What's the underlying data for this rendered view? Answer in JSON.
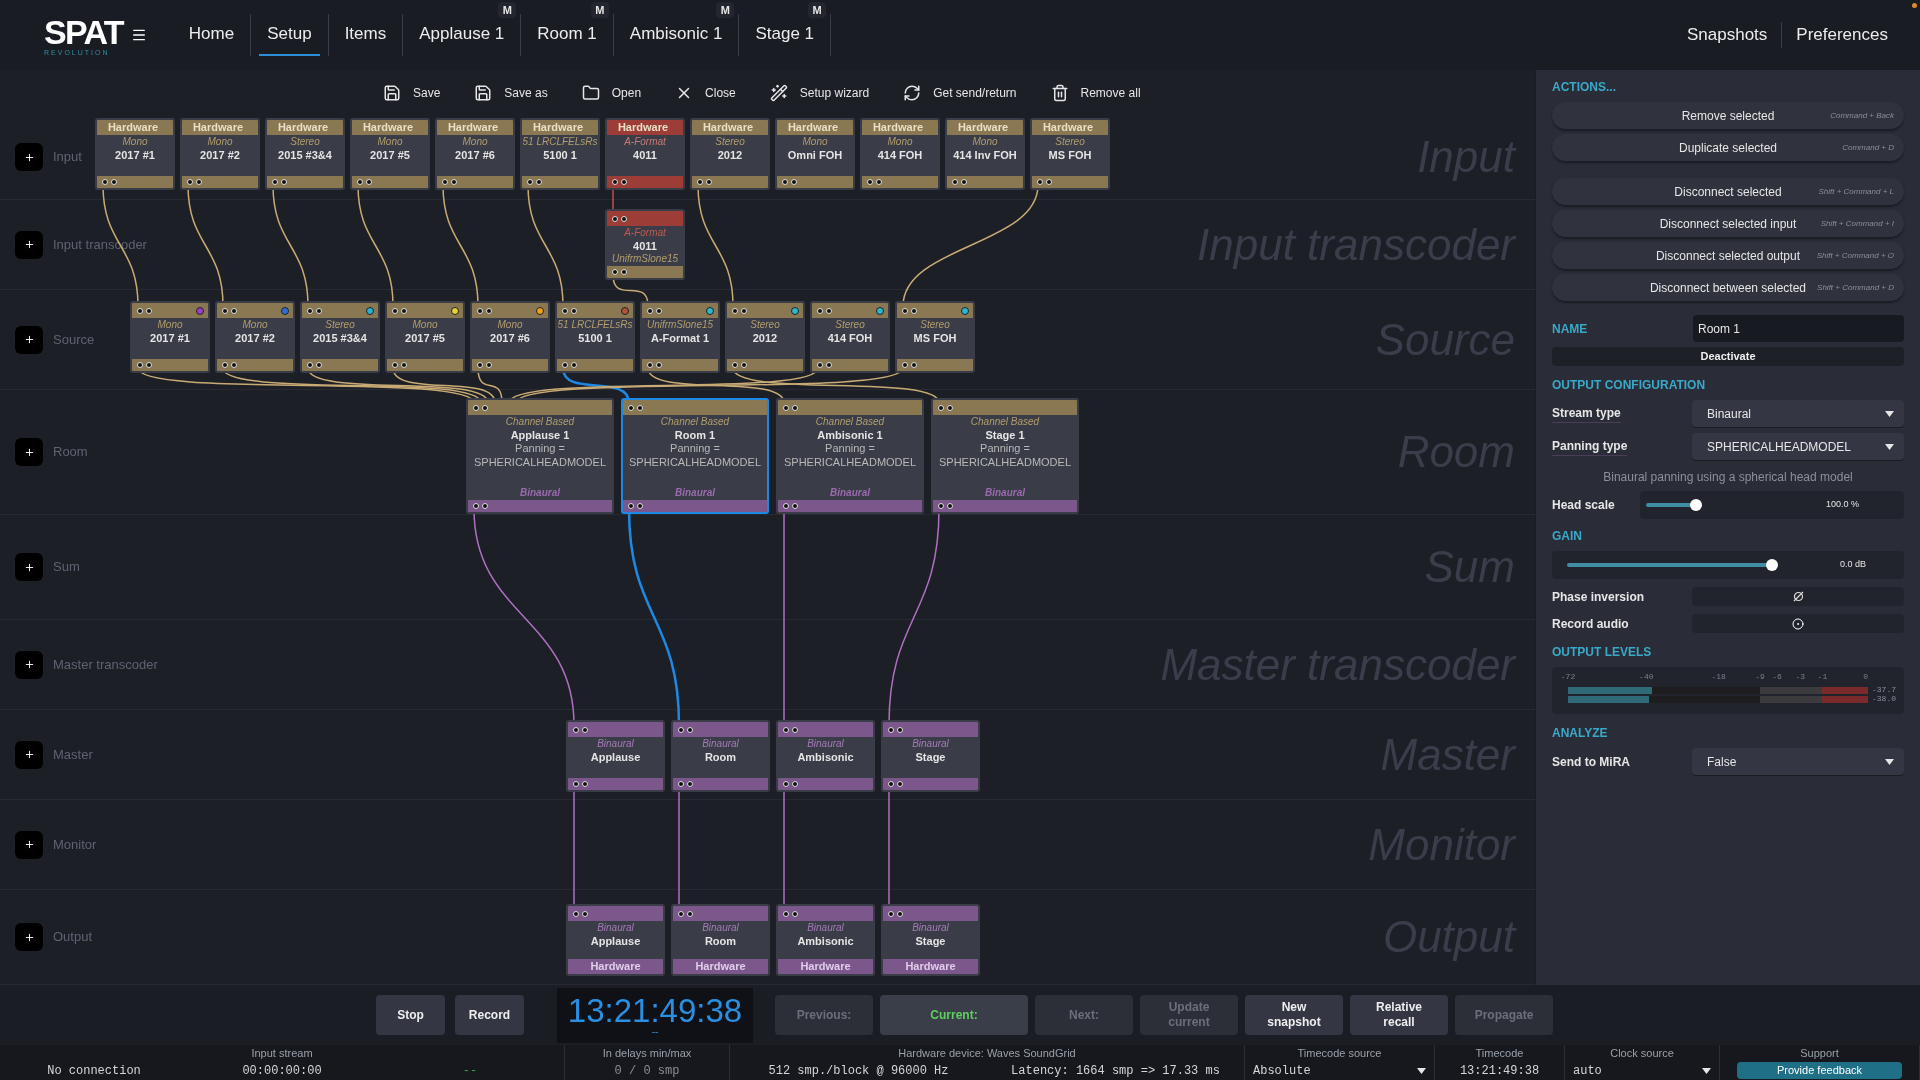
{
  "app": {
    "logo": "SPAT",
    "logo_sub": "REVOLUTION"
  },
  "nav": {
    "tabs": [
      {
        "label": "Home",
        "selected": false
      },
      {
        "label": "Setup",
        "selected": true
      },
      {
        "label": "Items",
        "selected": false
      },
      {
        "label": "Applause 1",
        "selected": false,
        "badge": "M"
      },
      {
        "label": "Room 1",
        "selected": false,
        "badge": "M"
      },
      {
        "label": "Ambisonic 1",
        "selected": false,
        "badge": "M"
      },
      {
        "label": "Stage 1",
        "selected": false,
        "badge": "M"
      }
    ],
    "right_tabs": [
      {
        "label": "Snapshots"
      },
      {
        "label": "Preferences"
      }
    ]
  },
  "toolbar": [
    {
      "kind": "save",
      "label": "Save"
    },
    {
      "kind": "save_as",
      "label": "Save as"
    },
    {
      "kind": "open",
      "label": "Open"
    },
    {
      "kind": "close",
      "label": "Close"
    },
    {
      "kind": "wizard",
      "label": "Setup wizard"
    },
    {
      "kind": "refresh",
      "label": "Get send/return"
    },
    {
      "kind": "remove",
      "label": "Remove all"
    }
  ],
  "lanes": [
    {
      "kind": "input",
      "label": "Input",
      "backdrop": "Input",
      "nodes": [
        {
          "kind": "hardware",
          "header": "Hardware",
          "format": "Mono",
          "name": "2017 #1"
        },
        {
          "kind": "hardware",
          "header": "Hardware",
          "format": "Mono",
          "name": "2017 #2"
        },
        {
          "kind": "hardware",
          "header": "Hardware",
          "format": "Stereo",
          "name": "2015 #3&4"
        },
        {
          "kind": "hardware",
          "header": "Hardware",
          "format": "Mono",
          "name": "2017 #5"
        },
        {
          "kind": "hardware",
          "header": "Hardware",
          "format": "Mono",
          "name": "2017 #6"
        },
        {
          "kind": "hardware",
          "header": "Hardware",
          "format": "51 LRCLFELsRs",
          "name": "5100 1"
        },
        {
          "kind": "aformat",
          "header": "Hardware",
          "format": "A-Format",
          "name": "4011"
        },
        {
          "kind": "hardware",
          "header": "Hardware",
          "format": "Stereo",
          "name": "2012"
        },
        {
          "kind": "hardware",
          "header": "Hardware",
          "format": "Mono",
          "name": "Omni FOH"
        },
        {
          "kind": "hardware",
          "header": "Hardware",
          "format": "Mono",
          "name": "414 FOH"
        },
        {
          "kind": "hardware",
          "header": "Hardware",
          "format": "Mono",
          "name": "414 Inv FOH"
        },
        {
          "kind": "hardware",
          "header": "Hardware",
          "format": "Stereo",
          "name": "MS FOH"
        }
      ]
    },
    {
      "kind": "input_transcoder",
      "label": "Input transcoder",
      "backdrop": "Input transcoder",
      "nodes": [
        {
          "kind": "aformat",
          "format": "A-Format",
          "name": "4011",
          "subformat": "UnifrmSlone15"
        }
      ]
    },
    {
      "kind": "source",
      "label": "Source",
      "backdrop": "Source",
      "nodes": [
        {
          "kind": "source",
          "format": "Mono",
          "name": "2017 #1",
          "color": "#9b3fc8"
        },
        {
          "kind": "source",
          "format": "Mono",
          "name": "2017 #2",
          "color": "#2f6fd6"
        },
        {
          "kind": "source",
          "format": "Stereo",
          "name": "2015 #3&4",
          "color": "#27b3d6"
        },
        {
          "kind": "source",
          "format": "Mono",
          "name": "2017 #5",
          "color": "#e6d23a"
        },
        {
          "kind": "source",
          "format": "Mono",
          "name": "2017 #6",
          "color": "#f0a020"
        },
        {
          "kind": "source",
          "format": "51 LRCLFELsRs",
          "name": "5100 1",
          "color": "#b0533a"
        },
        {
          "kind": "source",
          "format": "UnifrmSlone15",
          "name": "A-Format 1",
          "color": "#2bb7cf"
        },
        {
          "kind": "source",
          "format": "Stereo",
          "name": "2012",
          "color": "#2bb7cf"
        },
        {
          "kind": "source",
          "format": "Stereo",
          "name": "414 FOH",
          "color": "#2bb7cf"
        },
        {
          "kind": "source",
          "format": "Stereo",
          "name": "MS FOH",
          "color": "#2bb7cf"
        }
      ]
    },
    {
      "kind": "room",
      "label": "Room",
      "backdrop": "Room",
      "nodes": [
        {
          "kind": "room",
          "format": "Channel Based",
          "name": "Applause 1",
          "details": [
            "Panning =",
            "SPHERICALHEADMODEL"
          ],
          "body_footer": "Binaural",
          "selected": false
        },
        {
          "kind": "room",
          "format": "Channel Based",
          "name": "Room 1",
          "details": [
            "Panning =",
            "SPHERICALHEADMODEL"
          ],
          "body_footer": "Binaural",
          "selected": true
        },
        {
          "kind": "room",
          "format": "Channel Based",
          "name": "Ambisonic 1",
          "details": [
            "Panning =",
            "SPHERICALHEADMODEL"
          ],
          "body_footer": "Binaural",
          "selected": false
        },
        {
          "kind": "room",
          "format": "Channel Based",
          "name": "Stage 1",
          "details": [
            "Panning =",
            "SPHERICALHEADMODEL"
          ],
          "body_footer": "Binaural",
          "selected": false
        }
      ]
    },
    {
      "kind": "sum",
      "label": "Sum",
      "backdrop": "Sum"
    },
    {
      "kind": "master_transcoder",
      "label": "Master transcoder",
      "backdrop": "Master transcoder"
    },
    {
      "kind": "master",
      "label": "Master",
      "backdrop": "Master",
      "nodes": [
        {
          "kind": "master",
          "format": "Binaural",
          "name": "Applause"
        },
        {
          "kind": "master",
          "format": "Binaural",
          "name": "Room"
        },
        {
          "kind": "master",
          "format": "Binaural",
          "name": "Ambisonic"
        },
        {
          "kind": "master",
          "format": "Binaural",
          "name": "Stage"
        }
      ]
    },
    {
      "kind": "monitor",
      "label": "Monitor",
      "backdrop": "Monitor"
    },
    {
      "kind": "output",
      "label": "Output",
      "backdrop": "Output",
      "nodes": [
        {
          "kind": "output",
          "format": "Binaural",
          "name": "Applause",
          "bottom_label": "Hardware"
        },
        {
          "kind": "output",
          "format": "Binaural",
          "name": "Room",
          "bottom_label": "Hardware"
        },
        {
          "kind": "output",
          "format": "Binaural",
          "name": "Ambisonic",
          "bottom_label": "Hardware"
        },
        {
          "kind": "output",
          "format": "Binaural",
          "name": "Stage",
          "bottom_label": "Hardware"
        }
      ]
    }
  ],
  "panel": {
    "actions_title": "ACTIONS...",
    "action_groups": [
      [
        {
          "label": "Remove selected",
          "shortcut": "Command + Back"
        },
        {
          "label": "Duplicate selected",
          "shortcut": "Command + D"
        }
      ],
      [
        {
          "label": "Disconnect selected",
          "shortcut": "Shift + Command + L"
        },
        {
          "label": "Disconnect selected input",
          "shortcut": "Shift + Command + I"
        },
        {
          "label": "Disconnect selected output",
          "shortcut": "Shift + Command + O"
        },
        {
          "label": "Disconnect between selected",
          "shortcut": "Shift + Command + D"
        }
      ]
    ],
    "name_label": "NAME",
    "name_value": "Room 1",
    "deactivate": "Deactivate",
    "output_title": "OUTPUT CONFIGURATION",
    "stream_type": {
      "label": "Stream type",
      "value": "Binaural"
    },
    "panning_type": {
      "label": "Panning type",
      "value": "SPHERICALHEADMODEL"
    },
    "panning_description": "Binaural panning using a spherical head model",
    "head_scale": {
      "label": "Head scale",
      "level": 0.3,
      "reading": "100.0 %"
    },
    "gain_title": "GAIN",
    "gain": {
      "level": 0.82,
      "reading": "0.0 dB"
    },
    "toggles": [
      {
        "kind": "phase",
        "label": "Phase inversion"
      },
      {
        "kind": "record",
        "label": "Record audio"
      }
    ],
    "levels_title": "OUTPUT LEVELS",
    "meter": {
      "ticks": [
        "-72",
        "-40",
        "-18",
        "-9",
        "-6",
        "-3",
        "-1",
        "0"
      ],
      "channels": [
        {
          "level": 0.28,
          "reading": "-37.7"
        },
        {
          "level": 0.27,
          "reading": "-38.0"
        }
      ]
    },
    "analyze_title": "ANALYZE",
    "send_to_mira": {
      "label": "Send to MiRA",
      "value": "False"
    }
  },
  "transport": {
    "buttons": [
      {
        "label": "Stop"
      },
      {
        "label": "Record"
      }
    ],
    "clock": {
      "time": "13:21:49:38",
      "sub": "--"
    },
    "snapshots": [
      {
        "label": "Previous:",
        "disabled": true,
        "current": false
      },
      {
        "label": "Current:",
        "disabled": false,
        "current": true
      },
      {
        "label": "Next:",
        "disabled": true,
        "current": false
      },
      {
        "label": "Update current",
        "disabled": true,
        "current": false
      },
      {
        "label": "New snapshot",
        "disabled": false,
        "current": false
      },
      {
        "label": "Relative recall",
        "disabled": false,
        "current": false
      },
      {
        "label": "Propagate",
        "disabled": true,
        "current": false
      }
    ]
  },
  "status": {
    "groups": [
      {
        "header": "Input stream",
        "cells": [
          {
            "kind": "text",
            "value": "No connection"
          },
          {
            "kind": "text",
            "value": "00:00:00:00"
          },
          {
            "kind": "ok",
            "value": "--"
          }
        ]
      },
      {
        "header": "In delays min/max",
        "cells": [
          {
            "kind": "dim",
            "value": "0 / 0 smp"
          }
        ]
      },
      {
        "header": "Hardware device: Waves SoundGrid",
        "cells": [
          {
            "kind": "text",
            "value": "512 smp./block @ 96000 Hz"
          },
          {
            "kind": "text",
            "value": "Latency: 1664 smp => 17.33 ms"
          }
        ]
      },
      {
        "header": "Timecode source",
        "cells": [
          {
            "kind": "select",
            "value": "Absolute"
          }
        ]
      },
      {
        "header": "Timecode",
        "cells": [
          {
            "kind": "text",
            "value": "13:21:49:38"
          }
        ]
      },
      {
        "header": "Clock source",
        "cells": [
          {
            "kind": "select",
            "value": "auto"
          }
        ]
      },
      {
        "header": "Support",
        "cells": [
          {
            "kind": "button",
            "value": "Provide feedback"
          }
        ]
      }
    ]
  }
}
